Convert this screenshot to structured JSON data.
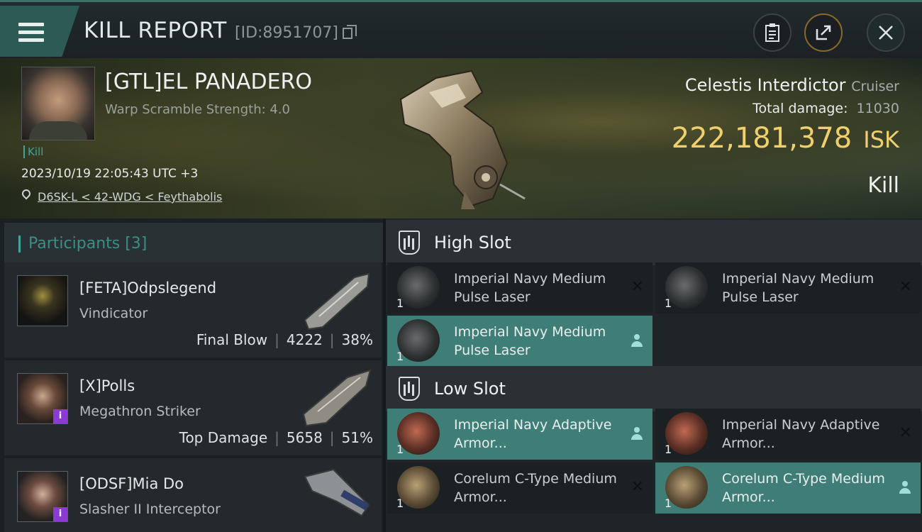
{
  "header": {
    "title": "KILL REPORT",
    "report_id": "[ID:8951707]"
  },
  "victim": {
    "name": "[GTL]EL PANADERO",
    "subtitle": "Warp Scramble Strength: 4.0",
    "tag": "Kill",
    "datetime": "2023/10/19 22:05:43 UTC +3",
    "location": "D6SK-L < 42-WDG < Feythabolis",
    "ship": "Celestis Interdictor",
    "ship_class": "Cruiser",
    "total_damage_label": "Total damage:",
    "total_damage": "11030",
    "isk_value": "222,181,378",
    "isk_unit": "ISK",
    "result": "Kill"
  },
  "participants": {
    "label": "Participants [3]",
    "items": [
      {
        "name": "[FETA]Odpslegend",
        "ship": "Vindicator",
        "role": "Final Blow",
        "damage": "4222",
        "percent": "38%"
      },
      {
        "name": "[X]Polls",
        "ship": "Megathron Striker",
        "role": "Top Damage",
        "damage": "5658",
        "percent": "51%"
      },
      {
        "name": "[ODSF]Mia Do",
        "ship": "Slasher II Interceptor"
      }
    ]
  },
  "slots": {
    "high": {
      "title": "High Slot",
      "modules": [
        {
          "qty": "1",
          "name": "Imperial Navy Medium Pulse Laser",
          "status": "destroyed"
        },
        {
          "qty": "1",
          "name": "Imperial Navy Medium Pulse Laser",
          "status": "destroyed"
        },
        {
          "qty": "1",
          "name": "Imperial Navy Medium Pulse Laser",
          "status": "dropped"
        }
      ]
    },
    "low": {
      "title": "Low Slot",
      "modules": [
        {
          "qty": "1",
          "name": "Imperial Navy Adaptive Armor...",
          "status": "dropped"
        },
        {
          "qty": "1",
          "name": "Imperial Navy Adaptive Armor...",
          "status": "destroyed"
        },
        {
          "qty": "1",
          "name": "Corelum C-Type Medium Armor...",
          "status": "destroyed"
        },
        {
          "qty": "1",
          "name": "Corelum C-Type Medium Armor...",
          "status": "dropped"
        }
      ]
    }
  },
  "icons": {
    "menu": "hamburger-icon",
    "copy": "copy-icon",
    "report": "clipboard-icon",
    "share": "share-icon",
    "close": "close-icon",
    "location": "location-pin-icon",
    "slot": "slot-shield-icon",
    "destroyed": "x-icon",
    "dropped": "person-icon"
  },
  "colors": {
    "accent": "#3fa69b",
    "isk": "#f0cf6e",
    "selected_row": "#3f7e77"
  }
}
